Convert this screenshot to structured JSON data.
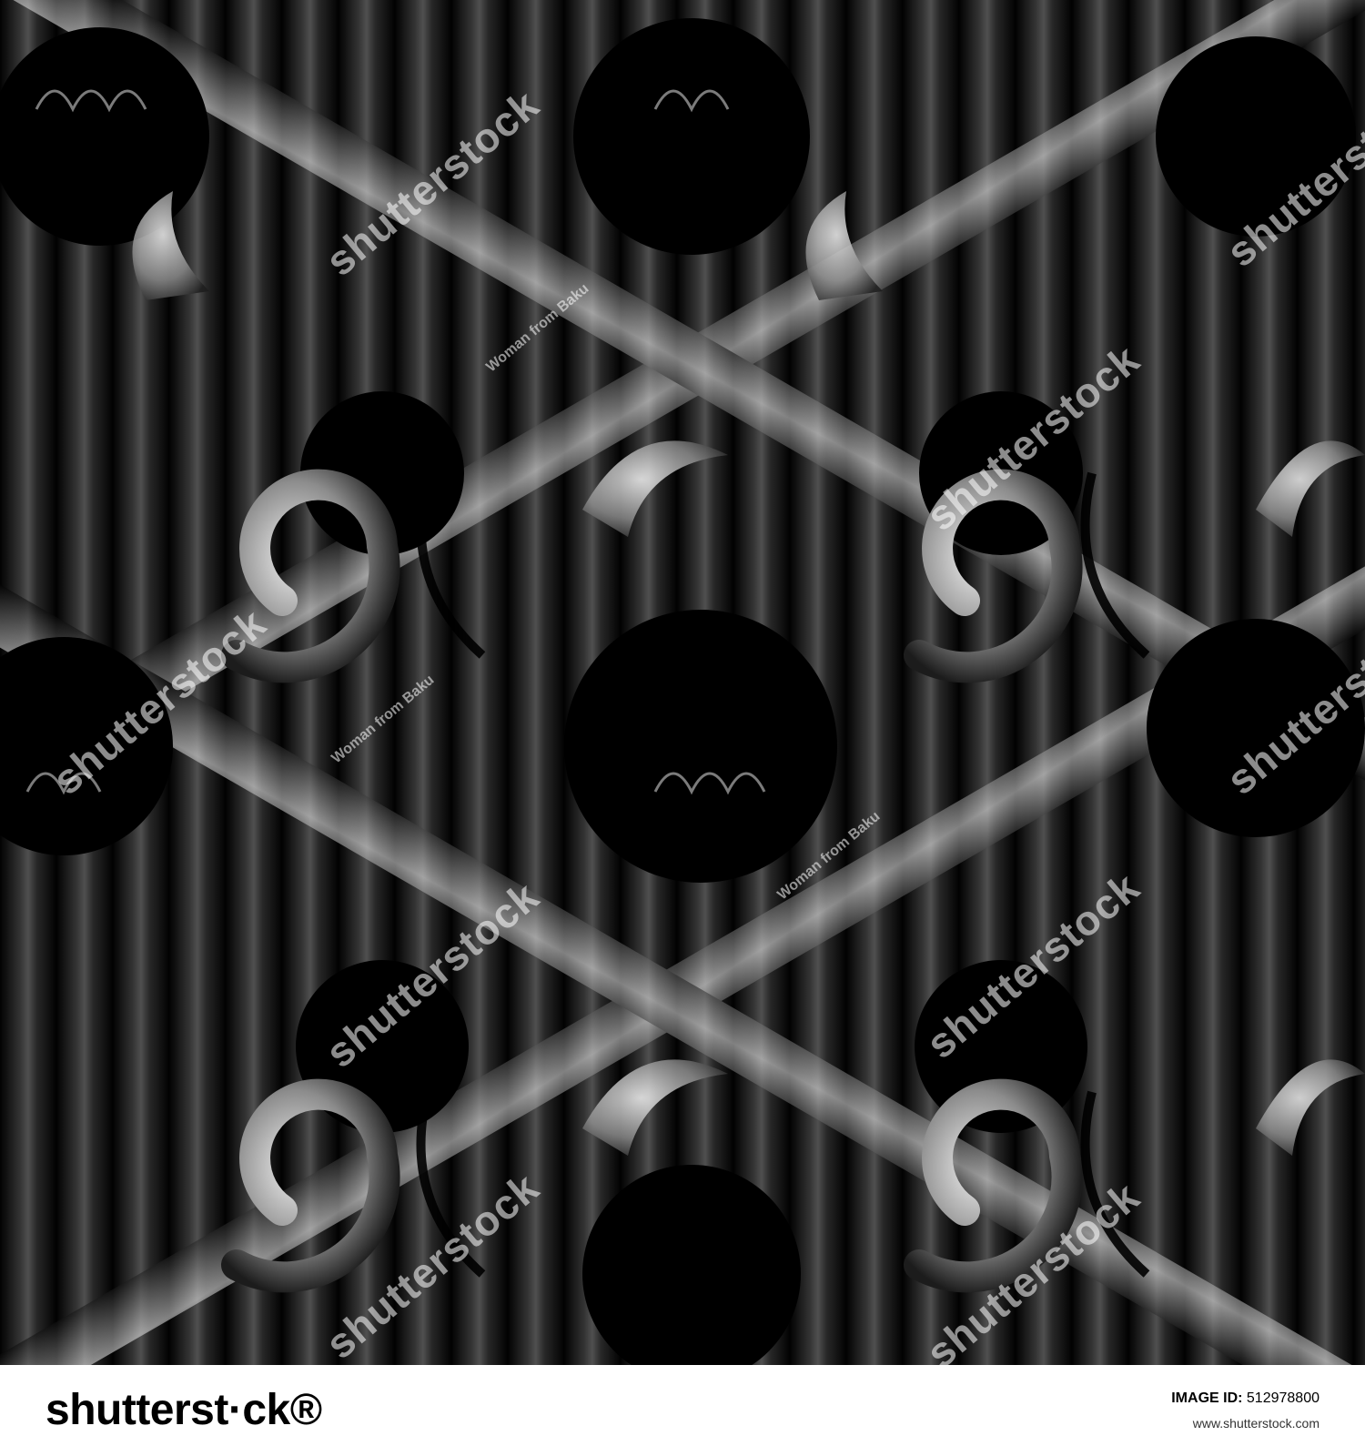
{
  "watermark": {
    "brand": "shutterstock",
    "brand_partial": "shutterst·ck",
    "author": "Woman from Baku"
  },
  "footer": {
    "logo": "shutterst·ck®",
    "image_id_label": "IMAGE ID:",
    "image_id_value": "512978800",
    "url": "www.shutterstock.com"
  },
  "colors": {
    "background": "#000000",
    "metal_light": "#e6e6e6",
    "metal_dark": "#1a1a1a",
    "footer_bg": "#ffffff"
  }
}
